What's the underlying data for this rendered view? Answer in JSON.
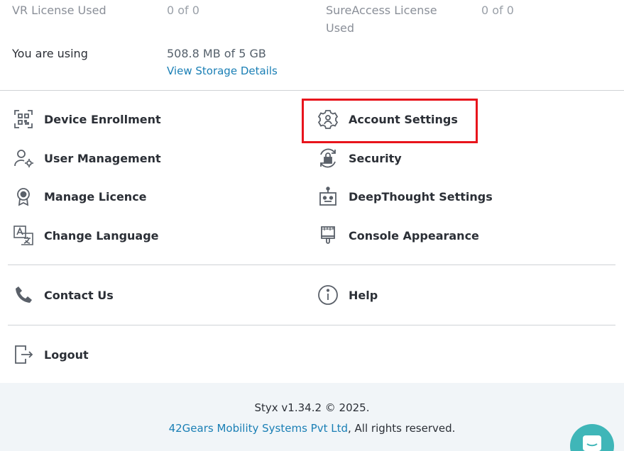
{
  "license": {
    "vr_label": "VR License Used",
    "vr_value": "0 of 0",
    "sureaccess_label_1": "SureAccess License",
    "sureaccess_label_2": "Used",
    "sureaccess_value": "0 of 0",
    "using_label": "You are using",
    "using_value": "508.8 MB of 5 GB",
    "storage_link": "View Storage Details"
  },
  "menu": {
    "device_enrollment": "Device Enrollment",
    "account_settings": "Account Settings",
    "user_management": "User Management",
    "security": "Security",
    "manage_licence": "Manage Licence",
    "deepthought_settings": "DeepThought Settings",
    "change_language": "Change Language",
    "console_appearance": "Console Appearance",
    "contact_us": "Contact Us",
    "help": "Help",
    "logout": "Logout"
  },
  "icons": {
    "device_enrollment": "qr-code-icon",
    "account_settings": "gear-user-icon",
    "user_management": "user-gear-icon",
    "security": "lock-refresh-icon",
    "manage_licence": "badge-icon",
    "deepthought_settings": "robot-icon",
    "change_language": "translate-icon",
    "console_appearance": "paint-brush-icon",
    "contact_us": "phone-icon",
    "help": "info-icon",
    "logout": "logout-icon"
  },
  "footer": {
    "version": "Styx v1.34.2 © 2025.",
    "company_link": "42Gears Mobility Systems Pvt Ltd",
    "rights": ", All rights reserved."
  },
  "colors": {
    "highlight": "#e8141c",
    "link": "#1a7fb5",
    "chat": "#3fb6b8"
  }
}
